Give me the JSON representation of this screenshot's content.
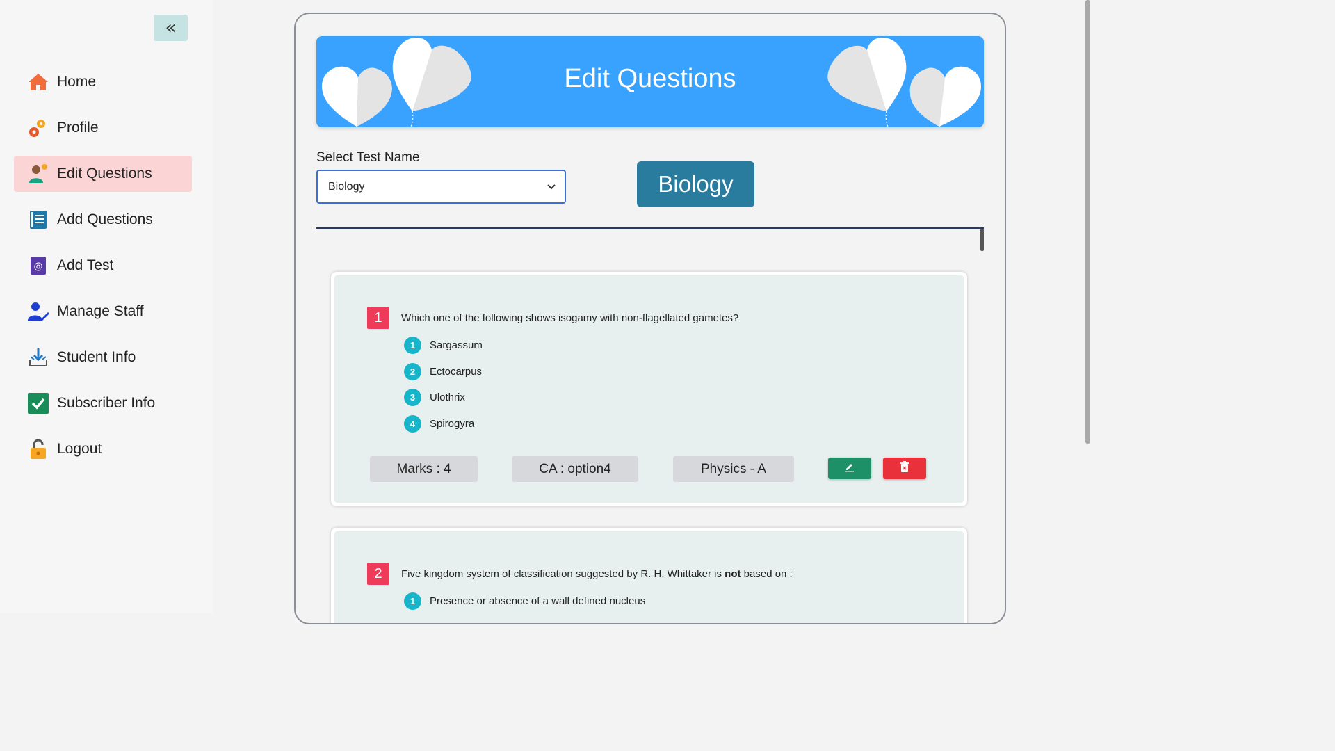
{
  "sidebar": {
    "collapse_icon": "double-chevron-left-icon",
    "collapse_label": "«",
    "items": [
      {
        "label": "Home",
        "icon": "home-icon"
      },
      {
        "label": "Profile",
        "icon": "gears-icon"
      },
      {
        "label": "Edit Questions",
        "icon": "person-edit-icon",
        "active": true
      },
      {
        "label": "Add Questions",
        "icon": "document-icon"
      },
      {
        "label": "Add Test",
        "icon": "at-sign-icon"
      },
      {
        "label": "Manage Staff",
        "icon": "user-edit-icon"
      },
      {
        "label": "Student Info",
        "icon": "download-tray-icon"
      },
      {
        "label": "Subscriber Info",
        "icon": "checkbox-icon"
      },
      {
        "label": "Logout",
        "icon": "unlock-icon"
      }
    ]
  },
  "banner": {
    "title": "Edit Questions"
  },
  "select": {
    "label": "Select Test Name",
    "value": "Biology"
  },
  "test_badge": "Biology",
  "questions": [
    {
      "number": "1",
      "text": "Which one of the following shows isogamy with non-flagellated gametes?",
      "options": [
        {
          "n": "1",
          "text": "Sargassum"
        },
        {
          "n": "2",
          "text": "Ectocarpus"
        },
        {
          "n": "3",
          "text": "Ulothrix"
        },
        {
          "n": "4",
          "text": "Spirogyra"
        }
      ],
      "marks": "Marks : 4",
      "correct_answer": "CA : option4",
      "subject": "Physics - A"
    },
    {
      "number": "2",
      "text_before": "Five kingdom system of classification suggested by R. H. Whittaker is ",
      "text_bold": "not",
      "text_after": " based on :",
      "options": [
        {
          "n": "1",
          "text": "Presence or absence of a wall defined nucleus"
        }
      ]
    }
  ],
  "colors": {
    "banner": "#39a2ff",
    "active_nav": "#fbd5d5",
    "badge": "#2a7c9e",
    "question_number": "#ef3b5a",
    "option_number": "#17b5c9",
    "edit_button": "#1e9068",
    "delete_button": "#e8313b"
  }
}
